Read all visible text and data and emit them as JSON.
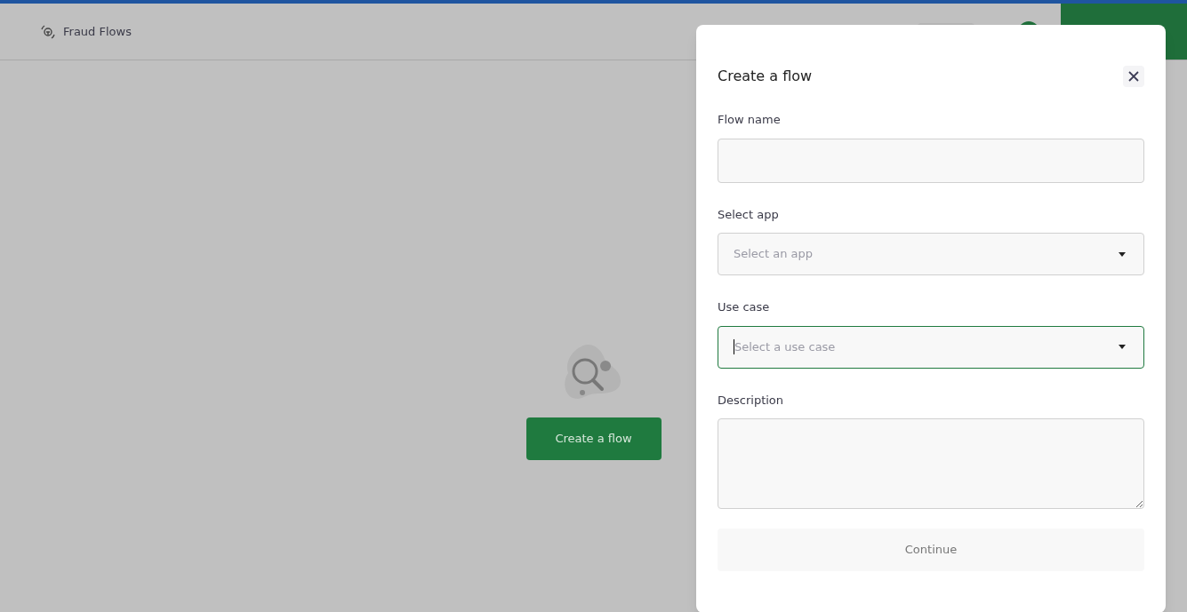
{
  "header": {
    "title": "Fraud Flows"
  },
  "empty_state": {
    "button": "Create a flow"
  },
  "dialog": {
    "title": "Create a flow",
    "fields": [
      {
        "kind": "text",
        "label": "Flow name",
        "focused": false
      },
      {
        "kind": "select",
        "label": "Select app",
        "placeholder": "Select an app",
        "focused": false
      },
      {
        "kind": "select",
        "label": "Use case",
        "placeholder": "Select a use case",
        "focused": true
      },
      {
        "kind": "textarea",
        "label": "Description",
        "focused": false
      }
    ],
    "submit": {
      "label": "Continue",
      "disabled": true
    }
  }
}
